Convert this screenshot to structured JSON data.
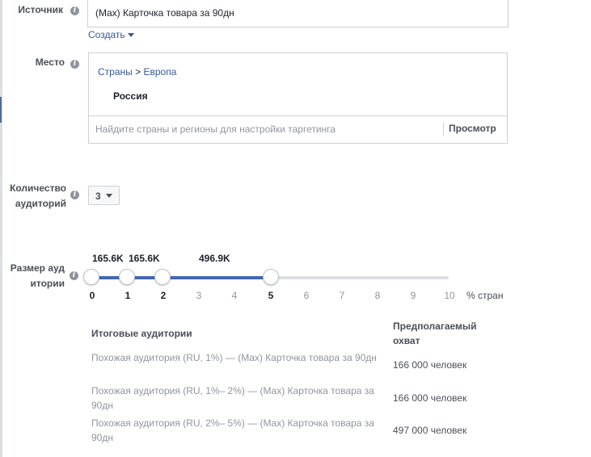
{
  "source": {
    "label": "Источник",
    "value": "(Max) Карточка товара за 90дн",
    "create_link": "Создать"
  },
  "place": {
    "label": "Место",
    "breadcrumb_countries": "Страны",
    "breadcrumb_sep": ">",
    "breadcrumb_region": "Европа",
    "selected_country": "Россия",
    "search_placeholder": "Найдите страны и регионы для настройки таргетинга",
    "browse_label": "Просмотр"
  },
  "audience_count": {
    "label": "Количество аудиторий",
    "selected": "3"
  },
  "audience_size": {
    "label": "Размер аудитории",
    "handle_values": [
      "165.6K",
      "165.6K",
      "496.9K"
    ],
    "handle_positions": [
      0,
      1,
      2,
      5
    ],
    "ticks": [
      "0",
      "1",
      "2",
      "3",
      "4",
      "5",
      "6",
      "7",
      "8",
      "9",
      "10"
    ],
    "unit": "% стран"
  },
  "results": {
    "col_audiences": "Итоговые аудитории",
    "col_reach": "Предполагаемый охват",
    "rows": [
      {
        "name": "Похожая аудитория (RU, 1%) — (Max) Карточка товара за 90дн",
        "reach": "166 000 человек"
      },
      {
        "name": "Похожая аудитория (RU, 1%– 2%) — (Max) Карточка товара за 90дн",
        "reach": "166 000 человек"
      },
      {
        "name": "Похожая аудитория (RU, 2%– 5%) — (Max) Карточка товара за 90дн",
        "reach": "497 000 человек"
      }
    ]
  },
  "colors": {
    "accent": "#4267b2",
    "link": "#365899",
    "text": "#1d2129",
    "muted": "#90949c"
  }
}
